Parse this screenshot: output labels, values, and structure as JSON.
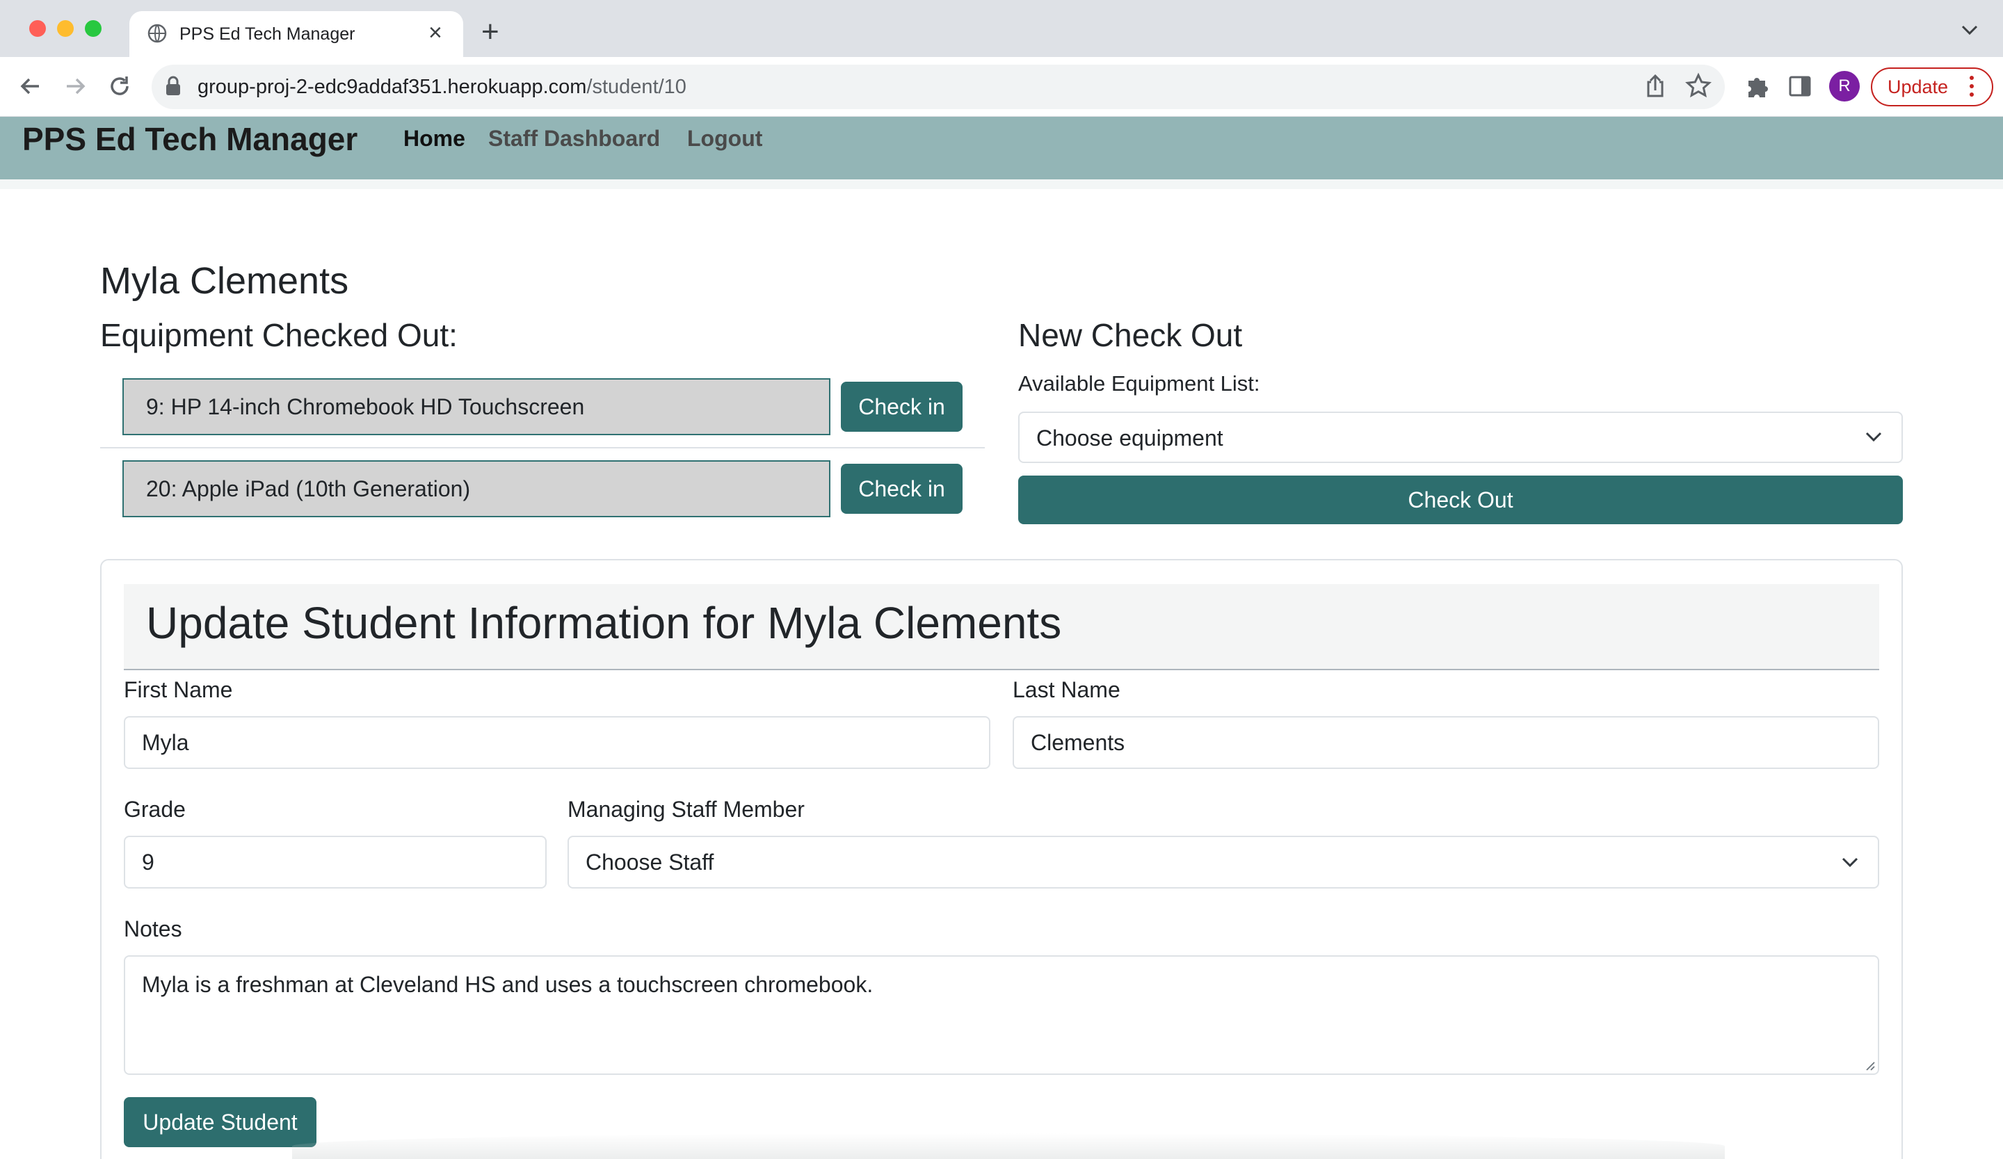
{
  "browser": {
    "tab_title": "PPS Ed Tech Manager",
    "url_host": "group-proj-2-edc9addaf351.herokuapp.com",
    "url_path": "/student/10",
    "profile_initial": "R",
    "update_label": "Update"
  },
  "nav": {
    "brand": "PPS Ed Tech Manager",
    "links": [
      "Home",
      "Staff Dashboard",
      "Logout"
    ],
    "bar_color": "#93b5b6"
  },
  "student": {
    "name": "Myla Clements"
  },
  "equipment": {
    "heading": "Equipment Checked Out:",
    "items": [
      {
        "label": "9: HP 14-inch Chromebook HD Touchscreen",
        "button": "Check in"
      },
      {
        "label": "20: Apple iPad (10th Generation)",
        "button": "Check in"
      }
    ]
  },
  "checkout": {
    "heading": "New Check Out",
    "list_label": "Available Equipment List:",
    "select_value": "Choose equipment",
    "button": "Check Out"
  },
  "form": {
    "title": "Update Student Information for Myla Clements",
    "first_name_label": "First Name",
    "first_name_value": "Myla",
    "last_name_label": "Last Name",
    "last_name_value": "Clements",
    "grade_label": "Grade",
    "grade_value": "9",
    "staff_label": "Managing Staff Member",
    "staff_value": "Choose Staff",
    "notes_label": "Notes",
    "notes_value": "Myla is a freshman at Cleveland HS and uses a touchscreen chromebook.",
    "submit": "Update Student"
  },
  "colors": {
    "accent": "#2d6e6e",
    "field_bg": "#d3d3d3"
  }
}
